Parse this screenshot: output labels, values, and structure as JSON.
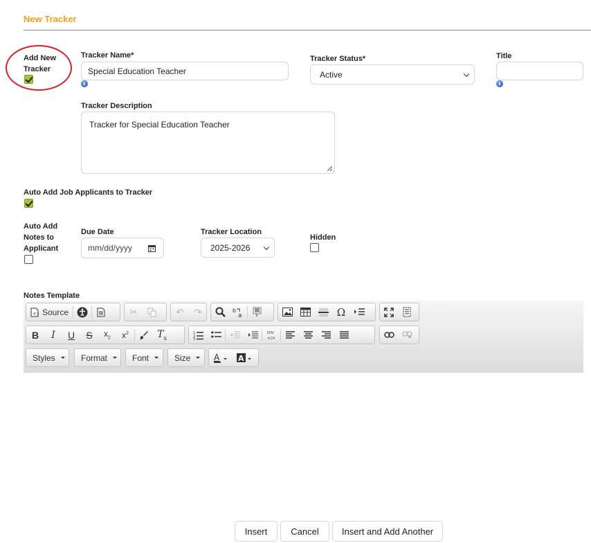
{
  "header": {
    "title": "New Tracker"
  },
  "add_new_tracker": {
    "label": "Add New Tracker",
    "checked": true
  },
  "tracker_name": {
    "label": "Tracker Name*",
    "value": "Special Education Teacher"
  },
  "tracker_status": {
    "label": "Tracker Status*",
    "value": "Active"
  },
  "title_field": {
    "label": "Title",
    "value": ""
  },
  "tracker_description": {
    "label": "Tracker Description",
    "value": "Tracker for Special Education Teacher"
  },
  "auto_add_applicants": {
    "label": "Auto Add Job Applicants to Tracker",
    "checked": true
  },
  "auto_add_notes": {
    "label": "Auto Add Notes to Applicant",
    "checked": false
  },
  "due_date": {
    "label": "Due Date",
    "placeholder": "mm/dd/yyyy"
  },
  "tracker_location": {
    "label": "Tracker Location",
    "value": "2025-2026"
  },
  "hidden": {
    "label": "Hidden",
    "checked": false
  },
  "notes_template": {
    "label": "Notes Template",
    "source_label": "Source",
    "combos": {
      "styles": "Styles",
      "format": "Format",
      "font": "Font",
      "size": "Size"
    }
  },
  "actions": {
    "insert": "Insert",
    "cancel": "Cancel",
    "insert_add_another": "Insert and Add Another"
  },
  "colors": {
    "accent": "#f5a21a",
    "checkbox_on": "#a4c639",
    "highlight_circle": "#d6232a",
    "info_icon": "#1f56b8"
  }
}
